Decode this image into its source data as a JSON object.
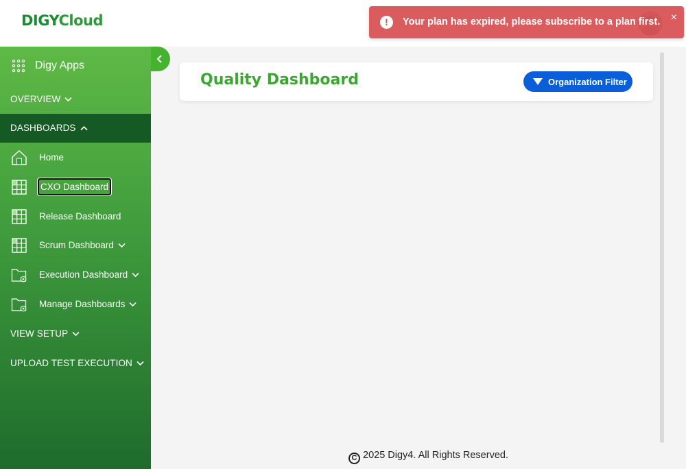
{
  "header": {
    "logo_part1": "DIGY",
    "logo_part2": "Cloud"
  },
  "toast": {
    "message": "Your plan has expired, please subscribe to a plan first.",
    "icon": "!",
    "close": "×"
  },
  "sidebar": {
    "apps_label": "Digy Apps",
    "overview": "OVERVIEW",
    "dashboards": "DASHBOARDS",
    "items": [
      {
        "label": "Home"
      },
      {
        "label": "CXO Dashboard"
      },
      {
        "label": "Release Dashboard"
      },
      {
        "label": "Scrum Dashboard"
      },
      {
        "label": "Execution Dashboard"
      },
      {
        "label": "Manage Dashboards"
      }
    ],
    "view_setup": "VIEW SETUP",
    "upload": "UPLOAD TEST EXECUTION"
  },
  "main": {
    "title": "Quality Dashboard",
    "filter_label": "Organization Filter"
  },
  "footer": {
    "copy_symbol": "C",
    "text": "2025 Digy4. All Rights Reserved."
  },
  "colors": {
    "brand_green": "#3aa82e",
    "sidebar_active": "#155a25",
    "filter_blue": "#0a5fd8",
    "toast_red": "#d64a4e"
  }
}
